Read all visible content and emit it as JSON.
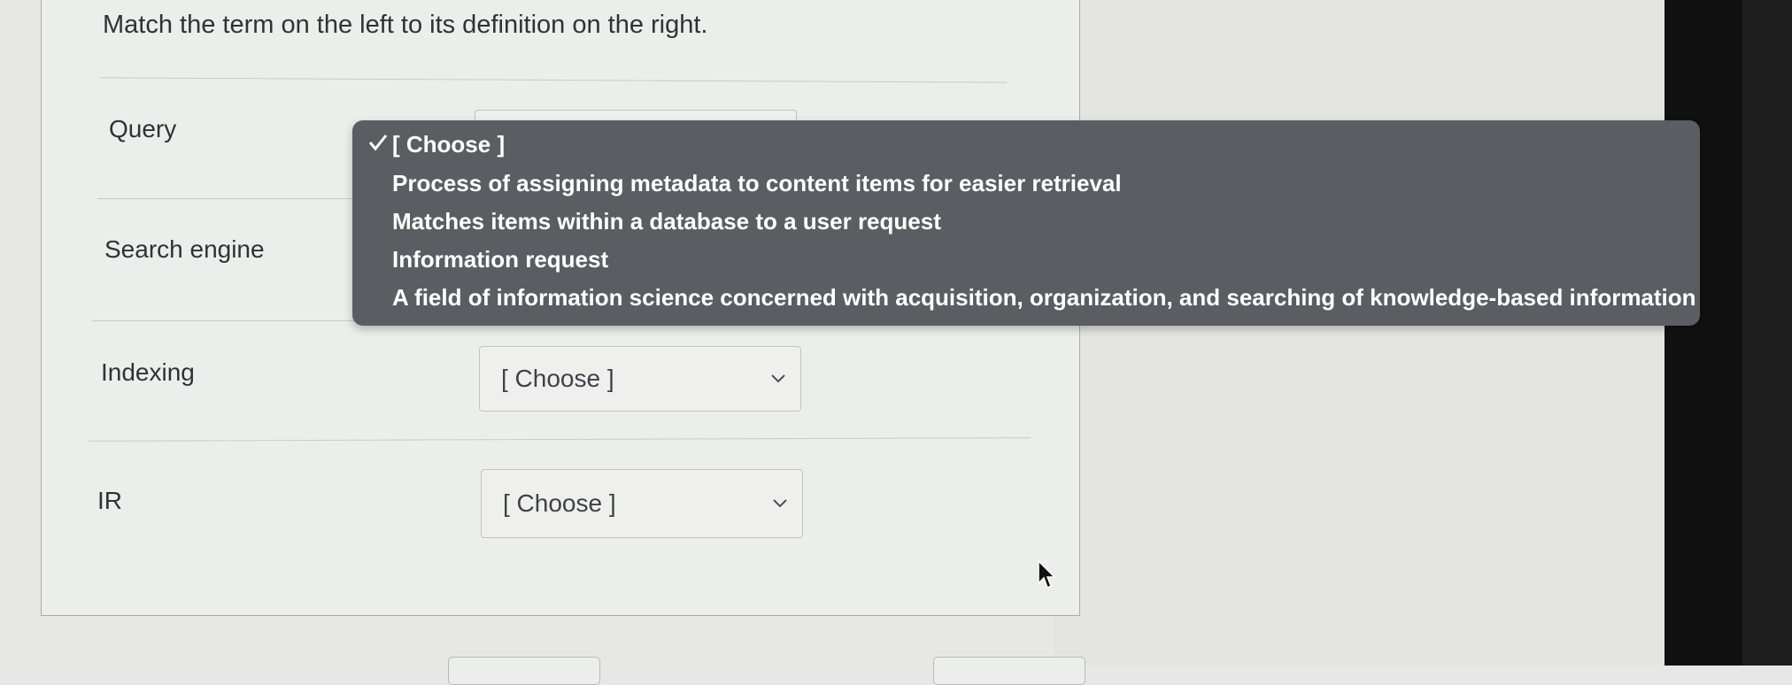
{
  "question": {
    "prompt": "Match the term on the left to its definition on the right."
  },
  "rows": [
    {
      "term": "Query",
      "selected": "[ Choose ]"
    },
    {
      "term": "Search engine",
      "selected": "[ Choose ]"
    },
    {
      "term": "Indexing",
      "selected": "[ Choose ]"
    },
    {
      "term": "IR",
      "selected": "[ Choose ]"
    }
  ],
  "dropdown": {
    "options": [
      "[ Choose ]",
      "Process of assigning metadata to content items for easier retrieval",
      "Matches items within a database to a user request",
      "Information request",
      "A field of information science concerned with acquisition, organization, and searching of knowledge-based information"
    ],
    "selected_index": 0
  },
  "icons": {
    "check": "checkmark-icon",
    "chevron": "chevron-down-icon",
    "cursor": "mouse-pointer-icon"
  }
}
